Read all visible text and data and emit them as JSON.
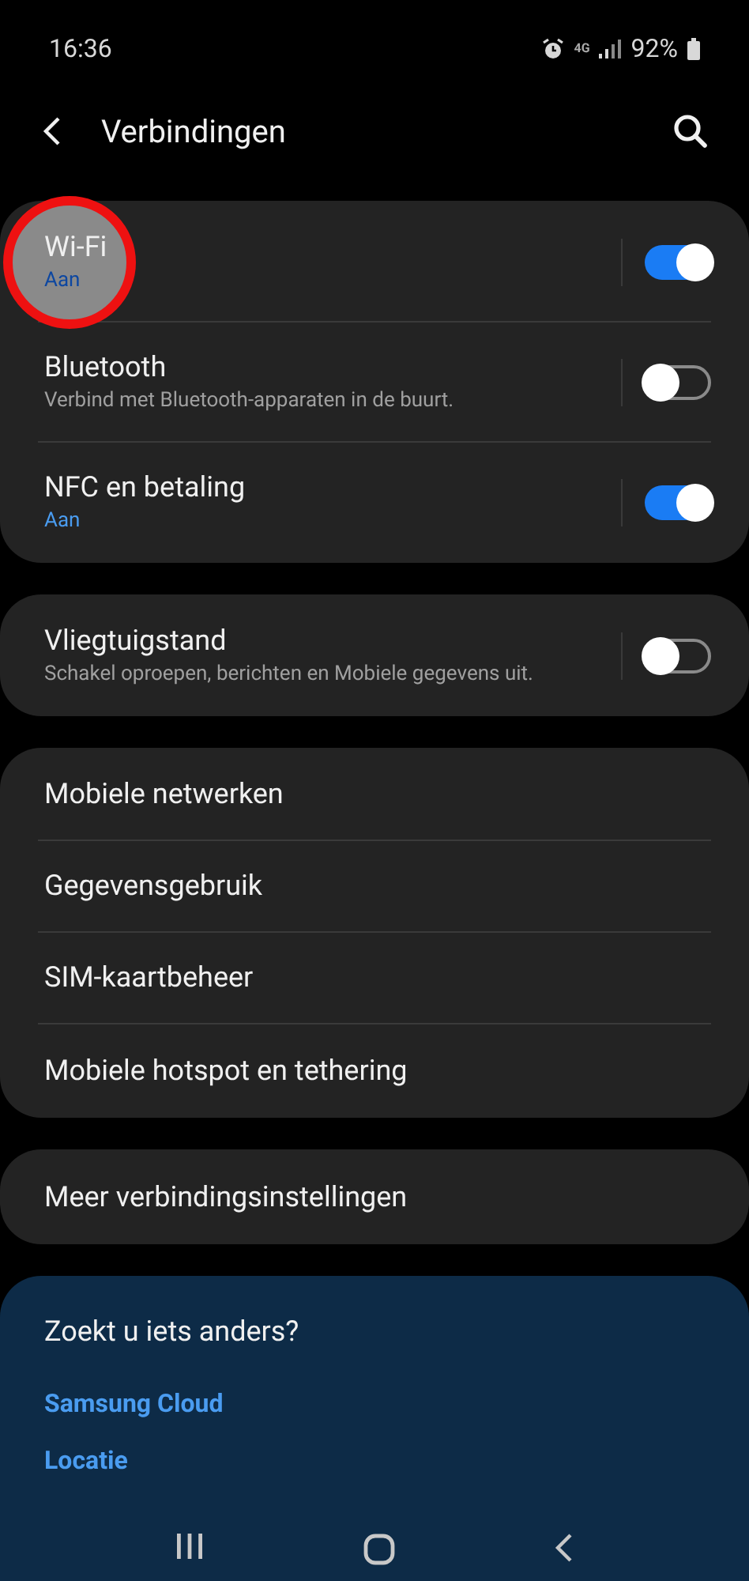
{
  "status_bar": {
    "time": "16:36",
    "network": "4G",
    "battery": "92%"
  },
  "header": {
    "title": "Verbindingen"
  },
  "groups": [
    {
      "items": [
        {
          "kind": "toggle",
          "label": "Wi-Fi",
          "subtitle": "Aan",
          "subtitle_accent": true,
          "on": true,
          "highlighted": true
        },
        {
          "kind": "toggle",
          "label": "Bluetooth",
          "subtitle": "Verbind met Bluetooth-apparaten in de buurt.",
          "subtitle_accent": false,
          "on": false,
          "highlighted": false
        },
        {
          "kind": "toggle",
          "label": "NFC en betaling",
          "subtitle": "Aan",
          "subtitle_accent": true,
          "on": true,
          "highlighted": false
        }
      ]
    },
    {
      "items": [
        {
          "kind": "toggle",
          "label": "Vliegtuigstand",
          "subtitle": "Schakel oproepen, berichten en Mobiele gegevens uit.",
          "subtitle_accent": false,
          "on": false,
          "highlighted": false
        }
      ]
    },
    {
      "items": [
        {
          "kind": "link",
          "label": "Mobiele netwerken"
        },
        {
          "kind": "link",
          "label": "Gegevensgebruik"
        },
        {
          "kind": "link",
          "label": "SIM-kaartbeheer"
        },
        {
          "kind": "link",
          "label": "Mobiele hotspot en tethering"
        }
      ]
    },
    {
      "items": [
        {
          "kind": "link",
          "label": "Meer verbindingsinstellingen"
        }
      ]
    }
  ],
  "suggestions": {
    "title": "Zoekt u iets anders?",
    "links": [
      "Samsung Cloud",
      "Locatie"
    ]
  }
}
